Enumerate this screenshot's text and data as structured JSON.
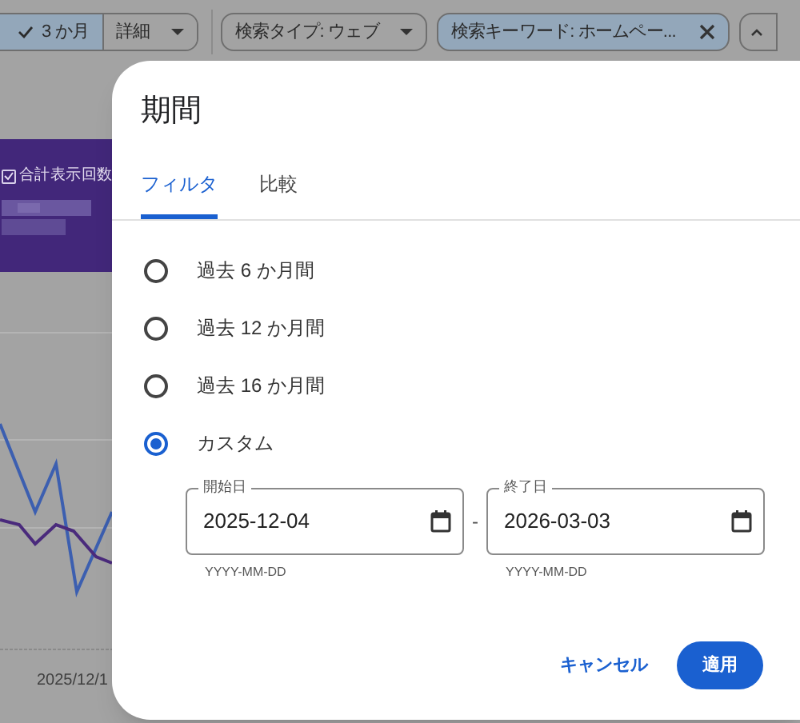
{
  "toolbar": {
    "chips": [
      {
        "label": "3 か月",
        "kind": "check",
        "selected": true
      },
      {
        "label": "詳細",
        "kind": "dropdown",
        "selected": false
      },
      {
        "label": "検索タイプ: ウェブ",
        "kind": "dropdown",
        "selected": false
      },
      {
        "label": "検索キーワード: ホームペー...",
        "kind": "removable",
        "selected": true
      }
    ]
  },
  "metric_card": {
    "label": "合計表示回数",
    "checked": true
  },
  "chart": {
    "x_label": "2025/12/1"
  },
  "dialog": {
    "title": "期間",
    "tabs": [
      {
        "label": "フィルタ",
        "selected": true
      },
      {
        "label": "比較",
        "selected": false
      }
    ],
    "options": [
      {
        "label": "過去 6 か月間",
        "selected": false
      },
      {
        "label": "過去 12 か月間",
        "selected": false
      },
      {
        "label": "過去 16 か月間",
        "selected": false
      },
      {
        "label": "カスタム",
        "selected": true
      }
    ],
    "start_date": {
      "label": "開始日",
      "value": "2025-12-04",
      "hint": "YYYY-MM-DD"
    },
    "separator": "-",
    "end_date": {
      "label": "終了日",
      "value": "2026-03-03",
      "hint": "YYYY-MM-DD"
    },
    "buttons": [
      {
        "label": "キャンセル",
        "kind": "text"
      },
      {
        "label": "適用",
        "kind": "filled"
      }
    ]
  }
}
